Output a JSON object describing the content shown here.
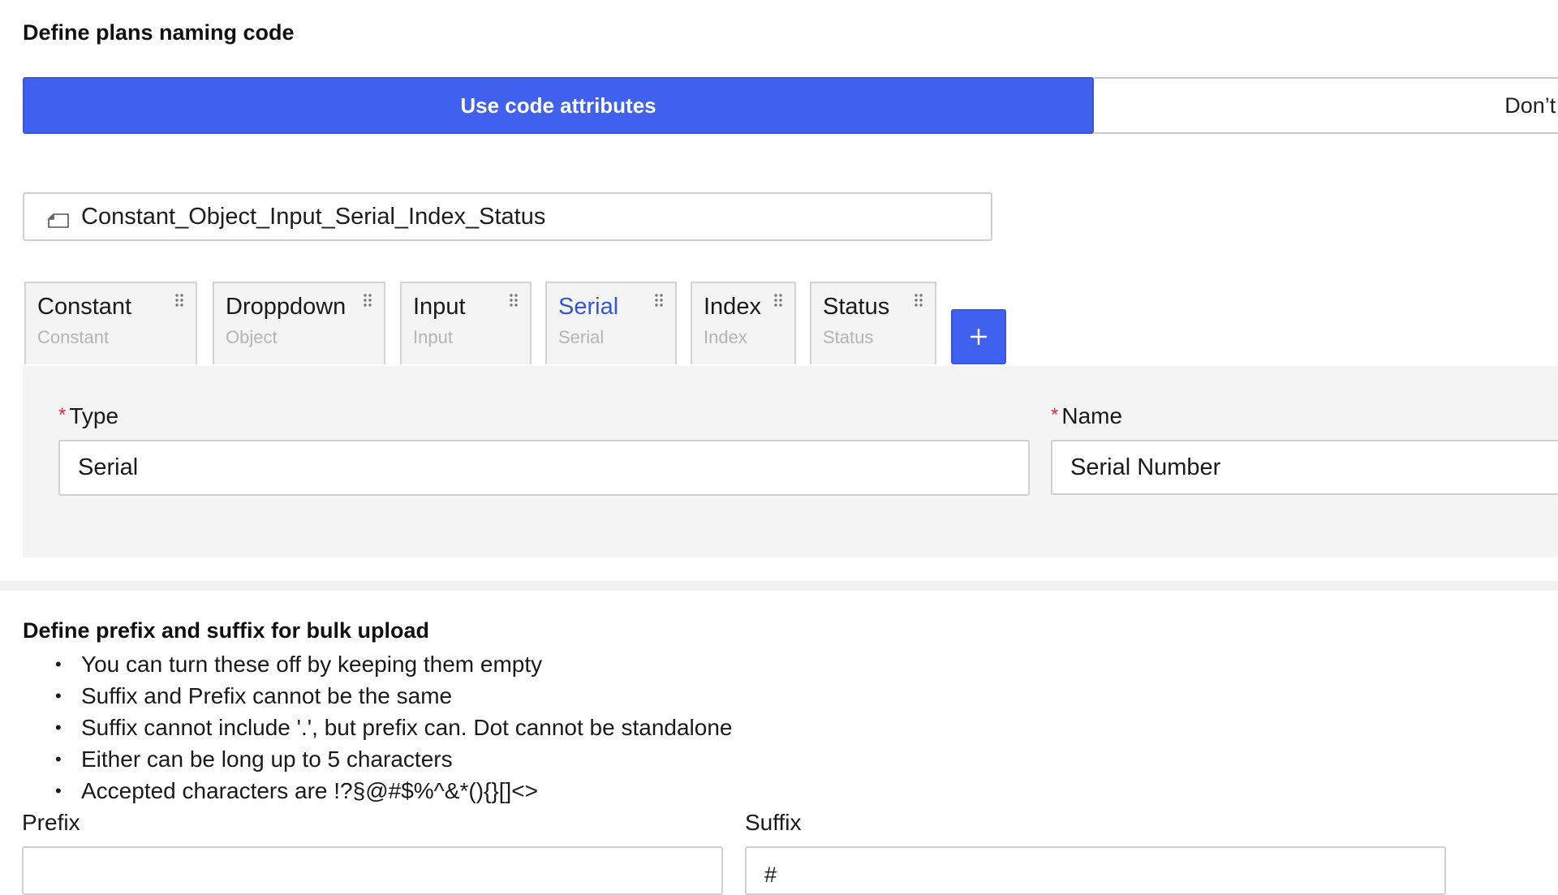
{
  "naming": {
    "title": "Define plans naming code",
    "toggle": {
      "active_label": "Use code attributes",
      "inactive_label": "Don’t d"
    },
    "code_preview": "Constant_Object_Input_Serial_Index_Status",
    "chips": [
      {
        "title": "Constant",
        "sub": "Constant",
        "active": false
      },
      {
        "title": "Droppdown",
        "sub": "Object",
        "active": false
      },
      {
        "title": "Input",
        "sub": "Input",
        "active": false
      },
      {
        "title": "Serial",
        "sub": "Serial",
        "active": true
      },
      {
        "title": "Index",
        "sub": "Index",
        "active": false
      },
      {
        "title": "Status",
        "sub": "Status",
        "active": false
      }
    ],
    "add_button": "+",
    "detail": {
      "required_mark": "*",
      "type_label": "Type",
      "type_value": "Serial",
      "name_label": "Name",
      "name_value": "Serial Number"
    }
  },
  "bulk": {
    "title": "Define prefix and suffix for bulk upload",
    "rules": [
      "You can turn these off by keeping them empty",
      "Suffix and Prefix cannot be the same",
      "Suffix cannot include '.', but prefix can. Dot cannot be standalone",
      "Either can be long up to 5 characters",
      "Accepted characters are !?§@#$%^&*(){}[]<>"
    ],
    "prefix_label": "Prefix",
    "prefix_value": "",
    "suffix_label": "Suffix",
    "suffix_value": "#"
  },
  "colors": {
    "accent": "#4060ee",
    "required": "#d0343a",
    "panel": "#f4f4f4",
    "active_chip_text": "#3556d6"
  },
  "icons": {
    "code_field": "tag-icon",
    "chip_handle": "drag-handle-icon",
    "add": "plus-icon"
  }
}
